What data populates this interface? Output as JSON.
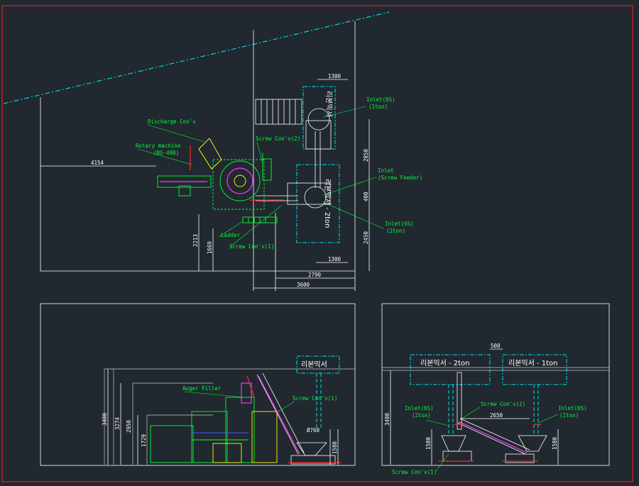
{
  "colors": {
    "background": "#212830",
    "frame": "#ff2020",
    "walls": "#ffffff",
    "labels": "#00ff33",
    "mixers": "#00e0e0",
    "conveyor": "#ff33ff",
    "accent": "#ffff00"
  },
  "plan": {
    "labels": {
      "discharge_conv": "Discharge Con'v",
      "rotary_machine": "Rotary machine",
      "rotary_model": "(BS-400)",
      "screw_conv2": "Screw Con'v(2)",
      "ladder": "Ladder",
      "screw_conv1": "Screw Con'v(1)",
      "inlet_6s_1ton": "Inlet(6S)",
      "inlet_6s_1ton_sub": "(1ton)",
      "inlet_feeder": "Inlet",
      "inlet_feeder_sub": "(Screw Feeder)",
      "inlet_6s_2ton": "Inlet(6S)",
      "inlet_6s_2ton_sub": "(2ton)",
      "mixer_1ton": "리본믹서",
      "mixer_2ton": "리본믹서 - 2ton"
    },
    "dims": {
      "d4154": "4154",
      "d1300_top": "1300",
      "d2850": "2850",
      "d400": "400",
      "d2450": "2450",
      "d1300_bot": "1300",
      "d2213": "2213",
      "d1669": "1669",
      "d2790": "2790",
      "d3600": "3600"
    }
  },
  "front": {
    "labels": {
      "auger_filler": "Auger Filler",
      "screw_conv1": "Screw Con'v(1)",
      "mixer": "리본믹서",
      "phi": "Ø760"
    },
    "dims": {
      "d3400": "3400",
      "d3274": "3274",
      "d2958": "2958",
      "d1729": "1729",
      "d1580": "1580"
    }
  },
  "side": {
    "labels": {
      "mixer_2ton": "리본믹서 - 2ton",
      "mixer_1ton": "리본믹서 - 1ton",
      "inlet_6s_2ton": "Inlet(6S)",
      "inlet_6s_2ton_sub": "(2ton)",
      "inlet_6s_1ton": "Inlet(6S)",
      "inlet_6s_1ton_sub": "(1ton)",
      "screw_conv2": "Screw Con'v(2)",
      "screw_conv1": "Screw Con'v(1)"
    },
    "dims": {
      "d500": "500",
      "d2650": "2650",
      "d3400": "3400",
      "d1580_left": "1580",
      "d1580_right": "1580"
    }
  }
}
